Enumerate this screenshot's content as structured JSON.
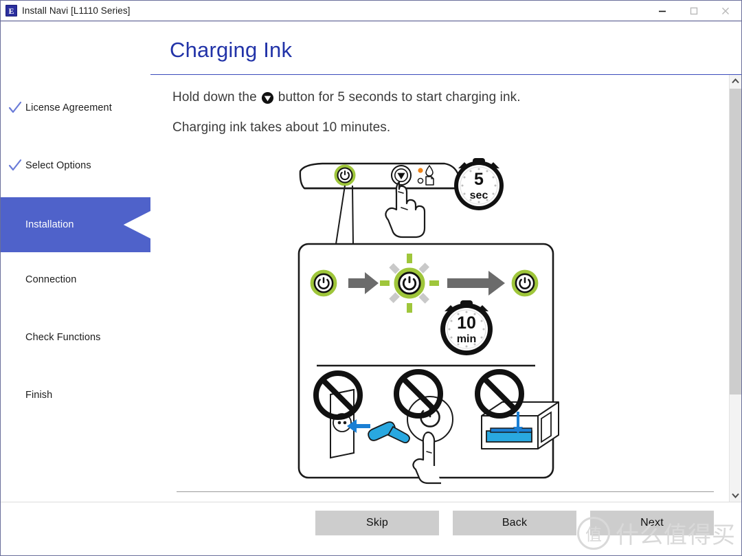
{
  "window": {
    "title": "Install Navi [L1110 Series]",
    "app_icon": "epson-e-icon",
    "controls": {
      "minimize": "minimize-icon",
      "maximize": "maximize-icon",
      "close": "close-icon"
    }
  },
  "sidebar": {
    "items": [
      {
        "label": "License Agreement",
        "state": "done"
      },
      {
        "label": "Select Options",
        "state": "done"
      },
      {
        "label": "Installation",
        "state": "active"
      },
      {
        "label": "Connection",
        "state": "pending"
      },
      {
        "label": "Check Functions",
        "state": "pending"
      },
      {
        "label": "Finish",
        "state": "pending"
      }
    ],
    "active_color": "#4f62ca",
    "check_color": "#6a7bd8"
  },
  "main": {
    "page_title": "Charging Ink",
    "instruction_line1_before": "Hold down the",
    "instruction_line1_button_icon": "ink-stop-button-icon",
    "instruction_line1_after": "button for 5 seconds to start charging ink.",
    "instruction_line2": "Charging ink takes about 10 minutes.",
    "illustration": {
      "panel_top": {
        "name": "printer-control-panel",
        "power_button": "power-button-icon",
        "ink_button": "ink-button-icon",
        "led_ink": "ink-led-lit",
        "led_paper": "paper-led-off",
        "finger": "pressing-finger-icon",
        "timer_value": "5",
        "timer_unit": "sec"
      },
      "panel_middle": {
        "name": "power-lamp-sequence",
        "step1": "power-lamp-steady",
        "step2": "power-lamp-blinking",
        "step3": "power-lamp-steady",
        "timer_value": "10",
        "timer_unit": "min"
      },
      "panel_bottom": {
        "name": "prohibited-actions",
        "items": [
          "do-not-unplug-power-cord",
          "do-not-press-power-button",
          "do-not-open-printer-cover"
        ]
      }
    }
  },
  "footer": {
    "buttons": [
      {
        "label": "Skip",
        "name": "skip-button"
      },
      {
        "label": "Back",
        "name": "back-button"
      },
      {
        "label": "Next",
        "name": "next-button"
      }
    ]
  },
  "watermark": {
    "badge": "值",
    "text": "什么值得买"
  },
  "scrollbar": {
    "up": "chevron-up-icon",
    "down": "chevron-down-icon"
  }
}
